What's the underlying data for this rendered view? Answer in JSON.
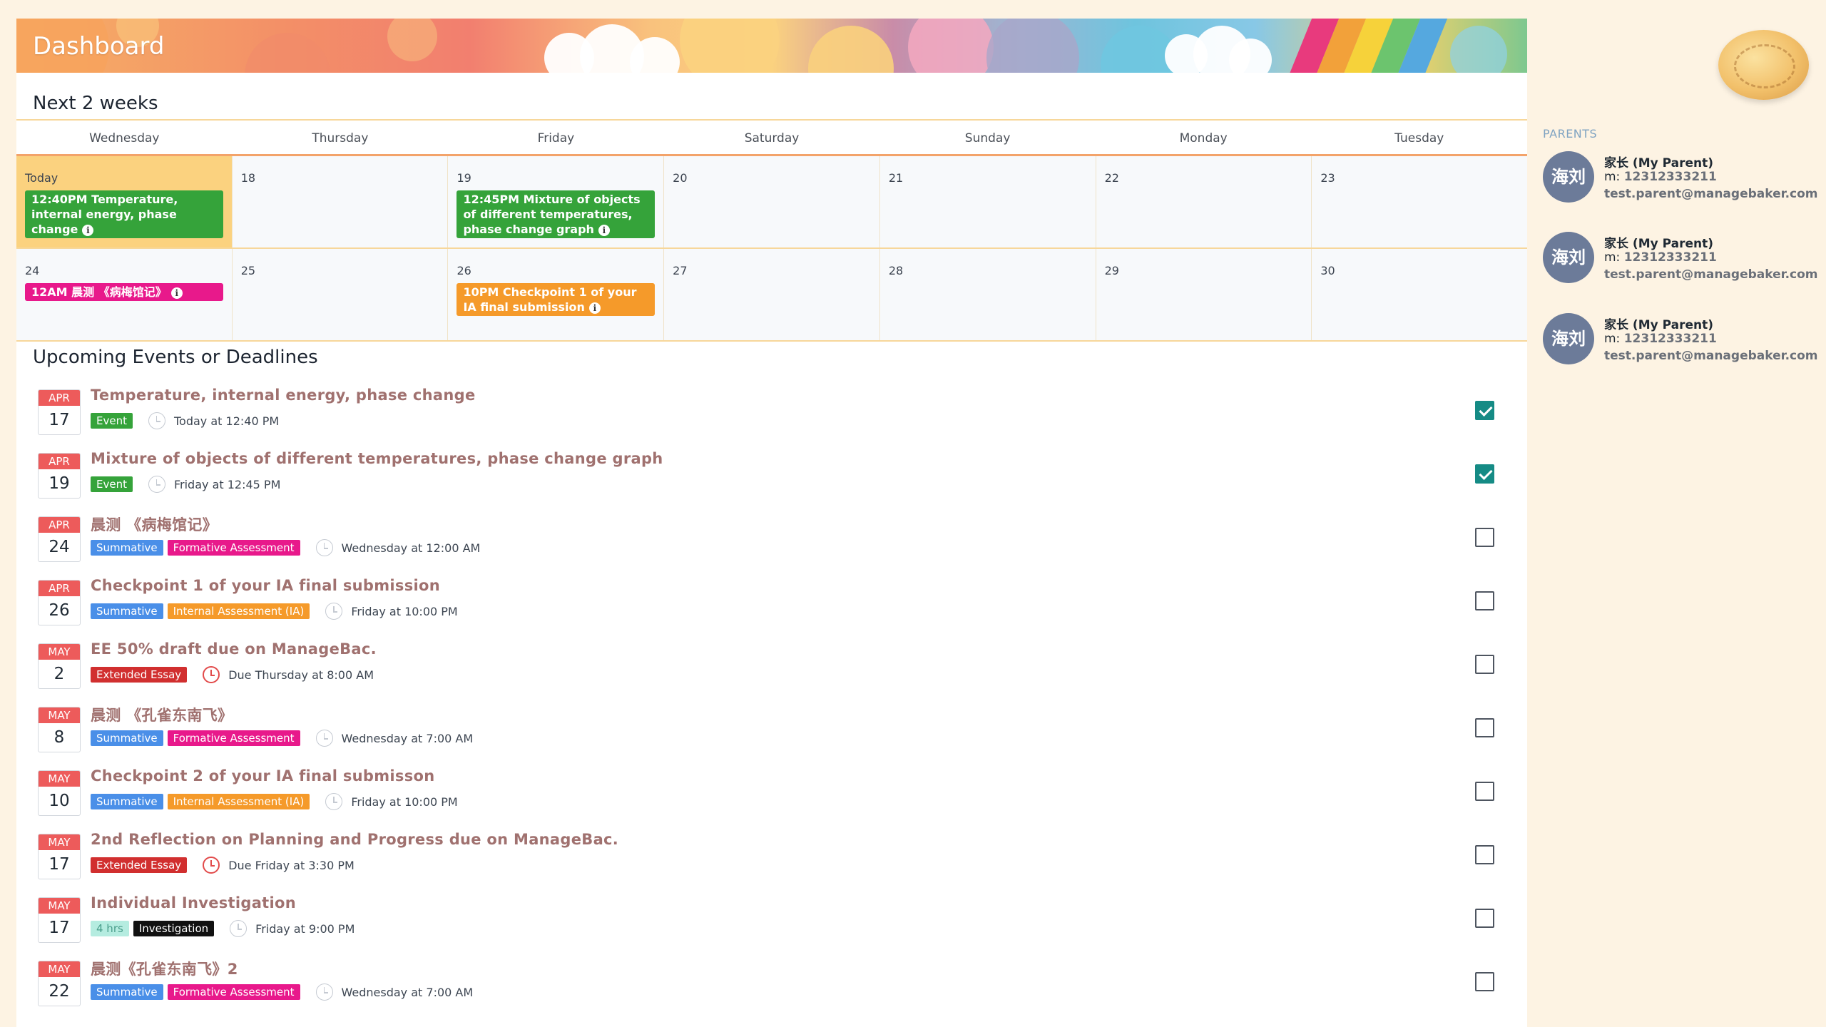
{
  "header": {
    "title": "Dashboard"
  },
  "calendar": {
    "title": "Next 2 weeks",
    "weekdays": [
      "Wednesday",
      "Thursday",
      "Friday",
      "Saturday",
      "Sunday",
      "Monday",
      "Tuesday"
    ],
    "rows": [
      [
        "Today",
        "18",
        "19",
        "20",
        "21",
        "22",
        "23"
      ],
      [
        "24",
        "25",
        "26",
        "27",
        "28",
        "29",
        "30"
      ]
    ],
    "events": [
      {
        "text": "12:40PM Temperature, internal energy, phase change",
        "color": "#35a33a"
      },
      {
        "text": "12:45PM Mixture of objects of different temperatures, phase change graph",
        "color": "#35a33a"
      },
      {
        "text": "12AM 晨测 《病梅馆记》",
        "color": "#e8198b"
      },
      {
        "text": "10PM Checkpoint 1 of your IA final submission",
        "color": "#f59a2a"
      }
    ]
  },
  "upcoming": {
    "title": "Upcoming Events or Deadlines",
    "items": [
      {
        "month": "APR",
        "day": "17",
        "title": "Temperature, internal energy, phase change",
        "tags": [
          "Event"
        ],
        "when": "Today at 12:40 PM",
        "checked": true
      },
      {
        "month": "APR",
        "day": "19",
        "title": "Mixture of objects of different temperatures, phase change graph",
        "tags": [
          "Event"
        ],
        "when": "Friday at 12:45 PM",
        "checked": true
      },
      {
        "month": "APR",
        "day": "24",
        "title": "晨测 《病梅馆记》",
        "tags": [
          "Summative",
          "Formative Assessment"
        ],
        "when": "Wednesday at 12:00 AM",
        "checked": false
      },
      {
        "month": "APR",
        "day": "26",
        "title": "Checkpoint 1 of your IA final submission",
        "tags": [
          "Summative",
          "Internal Assessment (IA)"
        ],
        "when": "Friday at 10:00 PM",
        "checked": false
      },
      {
        "month": "MAY",
        "day": "2",
        "title": "EE 50% draft due on ManageBac.",
        "tags": [
          "Extended Essay"
        ],
        "when": "Due Thursday at 8:00 AM",
        "checked": false
      },
      {
        "month": "MAY",
        "day": "8",
        "title": "晨测 《孔雀东南飞》",
        "tags": [
          "Summative",
          "Formative Assessment"
        ],
        "when": "Wednesday at 7:00 AM",
        "checked": false
      },
      {
        "month": "MAY",
        "day": "10",
        "title": "Checkpoint 2 of your IA final submisson",
        "tags": [
          "Summative",
          "Internal Assessment (IA)"
        ],
        "when": "Friday at 10:00 PM",
        "checked": false
      },
      {
        "month": "MAY",
        "day": "17",
        "title": "2nd Reflection on Planning and Progress due on ManageBac.",
        "tags": [
          "Extended Essay"
        ],
        "when": "Due Friday at 3:30 PM",
        "checked": false
      },
      {
        "month": "MAY",
        "day": "17",
        "title": "Individual Investigation",
        "tags": [
          "4 hrs",
          "Investigation"
        ],
        "when": "Friday at 9:00 PM",
        "checked": false
      },
      {
        "month": "MAY",
        "day": "22",
        "title": "晨测《孔雀东南飞》2",
        "tags": [
          "Summative",
          "Formative Assessment"
        ],
        "when": "Wednesday at 7:00 AM",
        "checked": false
      }
    ]
  },
  "tag_colors": {
    "Event": "#35a33a",
    "Summative": "#4a8fe8",
    "Formative Assessment": "#e8198b",
    "Internal Assessment (IA)": "#f59a2a",
    "Extended Essay": "#d12f2f",
    "4 hrs": "#b5ece0",
    "Investigation": "#111111"
  },
  "sidebar": {
    "parents_label": "PARENTS",
    "parents": [
      {
        "avatar": "海刘",
        "name": "家长 (My Parent)",
        "phone_prefix": "m: ",
        "phone": "12312333211",
        "email": "test.parent@managebaker.com"
      },
      {
        "avatar": "海刘",
        "name": "家长 (My Parent)",
        "phone_prefix": "m: ",
        "phone": "12312333211",
        "email": "test.parent@managebaker.com"
      },
      {
        "avatar": "海刘",
        "name": "家长 (My Parent)",
        "phone_prefix": "m: ",
        "phone": "12312333211",
        "email": "test.parent@managebaker.com"
      }
    ]
  }
}
